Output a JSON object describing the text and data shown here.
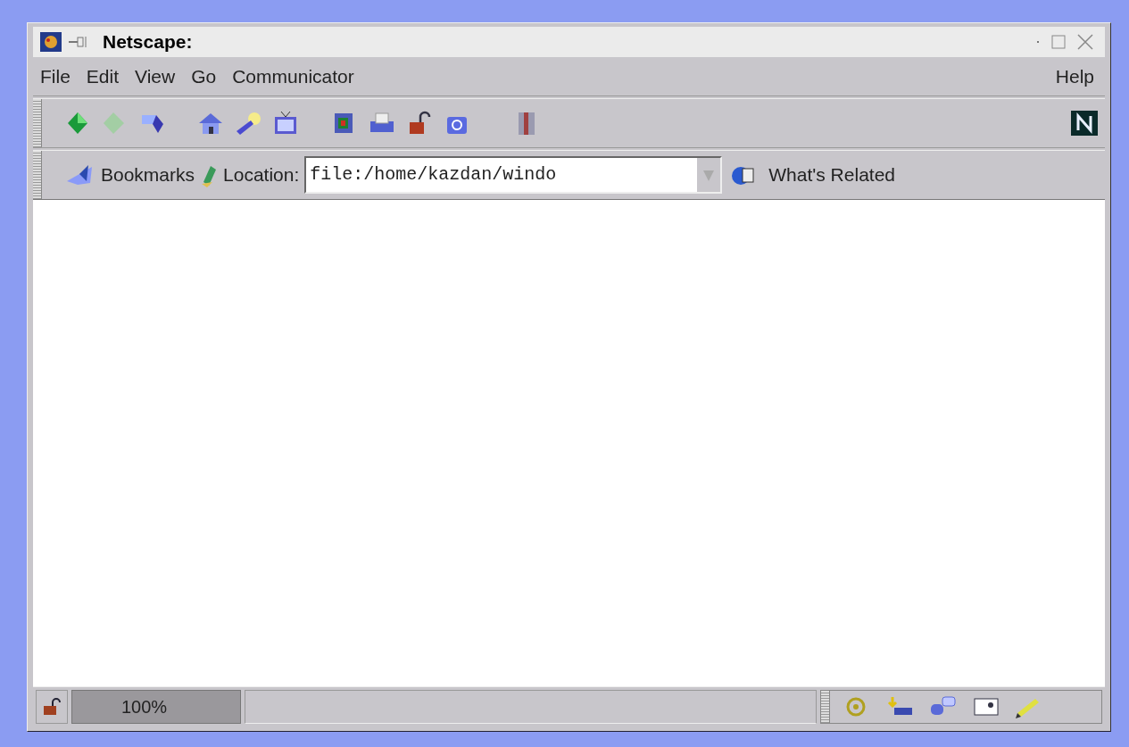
{
  "window": {
    "title": "Netscape:"
  },
  "menu": {
    "items": [
      {
        "label": "File"
      },
      {
        "label": "Edit"
      },
      {
        "label": "View"
      },
      {
        "label": "Go"
      },
      {
        "label": "Communicator"
      }
    ],
    "help": {
      "label": "Help"
    }
  },
  "location_bar": {
    "bookmarks": "Bookmarks",
    "location_label": "Location:",
    "url": "file:/home/kazdan/windo",
    "whats_related": "What's Related"
  },
  "status_bar": {
    "zoom": "100%"
  }
}
